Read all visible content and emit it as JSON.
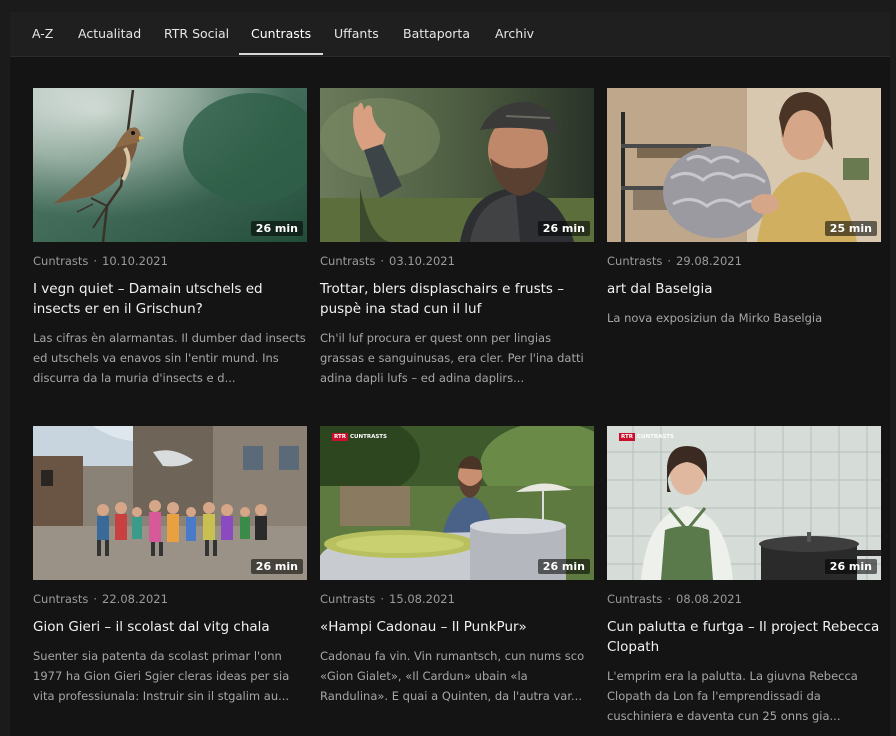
{
  "nav": {
    "items": [
      {
        "label": "A-Z"
      },
      {
        "label": "Actualitad"
      },
      {
        "label": "RTR Social"
      },
      {
        "label": "Cuntrasts"
      },
      {
        "label": "Uffants"
      },
      {
        "label": "Battaporta"
      },
      {
        "label": "Archiv"
      }
    ],
    "active": "Cuntrasts"
  },
  "channel_badge": {
    "box": "RTR",
    "word": "CUNTRASTS"
  },
  "colors": {
    "background": "#141414",
    "nav_background": "#1f1f1f",
    "title": "#f2f2f2",
    "meta": "#9b9b9b",
    "description": "#a6a6a6",
    "badge_red": "#c8102e"
  },
  "cards": [
    {
      "show": "Cuntrasts",
      "date": "10.10.2021",
      "duration": "26 min",
      "title": "I vegn quiet – Damain utschels ed insects er en il Grischun?",
      "description": "Las cifras èn alarmantas. Il dumber dad insects ed utschels va enavos sin l'entir mund. Ins discurra da la muria d'insects e d..."
    },
    {
      "show": "Cuntrasts",
      "date": "03.10.2021",
      "duration": "26 min",
      "title": "Trottar, blers displaschairs e frusts – puspè ina stad cun il luf",
      "description": "Ch'il luf procura er quest onn per lingias grassas e sanguinusas, era cler. Per l'ina datti adina dapli lufs – ed adina daplirs..."
    },
    {
      "show": "Cuntrasts",
      "date": "29.08.2021",
      "duration": "25 min",
      "title": "art dal Baselgia",
      "description": "La nova exposiziun da Mirko Baselgia"
    },
    {
      "show": "Cuntrasts",
      "date": "22.08.2021",
      "duration": "26 min",
      "title": "Gion Gieri – il scolast dal vitg chala",
      "description": "Suenter sia patenta da scolast primar l'onn 1977 ha Gion Gieri Sgier cleras ideas per sia vita professiunala: Instruir sin il stgalim au..."
    },
    {
      "show": "Cuntrasts",
      "date": "15.08.2021",
      "duration": "26 min",
      "title": "«Hampi Cadonau – Il PunkPur»",
      "description": "Cadonau fa vin. Vin rumantsch, cun nums sco «Gion Gialet», «Il Cardun» ubain «la Randulina». E quai a Quinten, da l'autra var..."
    },
    {
      "show": "Cuntrasts",
      "date": "08.08.2021",
      "duration": "26 min",
      "title": "Cun palutta e furtga – Il project Rebecca Clopath",
      "description": "L'emprim era la palutta. La giuvna Rebecca Clopath da Lon fa l'emprendissadi da cuschiniera e daventa cun 25 onns gia..."
    }
  ]
}
